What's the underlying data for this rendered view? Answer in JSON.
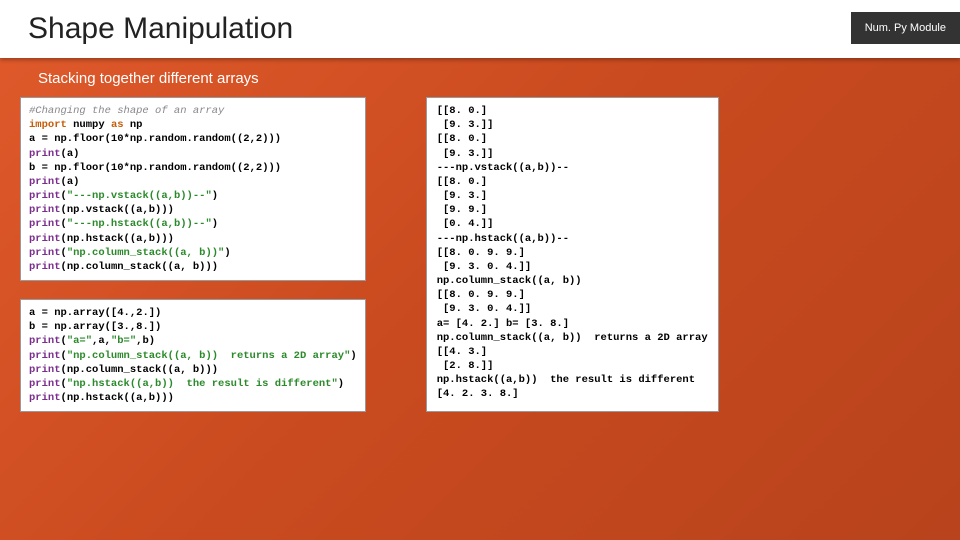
{
  "header": {
    "title": "Shape Manipulation",
    "badge": "Num. Py Module"
  },
  "subtitle": "Stacking together different arrays",
  "code1": {
    "l1": "#Changing the shape of an array",
    "l2_a": "import",
    "l2_b": "numpy",
    "l2_c": "as",
    "l2_d": "np",
    "l3_a": "a = np.",
    "l3_b": "floor(",
    "l3_c": "10",
    "l3_d": "*np.",
    "l3_e": "random.random((",
    "l3_f": "2",
    "l3_g": ",",
    "l3_h": "2",
    "l3_i": ")))",
    "l4_a": "print",
    "l4_b": "(a)",
    "l5_a": "b = np.",
    "l5_b": "floor(",
    "l5_c": "10",
    "l5_d": "*np.",
    "l5_e": "random.random((",
    "l5_f": "2",
    "l5_g": ",",
    "l5_h": "2",
    "l5_i": ")))",
    "l6_a": "print",
    "l6_b": "(a)",
    "l7_a": "print",
    "l7_b": "(",
    "l7_c": "\"---np.vstack((a,b))--\"",
    "l7_d": ")",
    "l8_a": "print",
    "l8_b": "(np.",
    "l8_c": "vstack((a,b)))",
    "l9_a": "print",
    "l9_b": "(",
    "l9_c": "\"---np.hstack((a,b))--\"",
    "l9_d": ")",
    "l10_a": "print",
    "l10_b": "(np.",
    "l10_c": "hstack((a,b)))",
    "l11_a": "print",
    "l11_b": "(",
    "l11_c": "\"np.column_stack((a, b))\"",
    "l11_d": ")",
    "l12_a": "print",
    "l12_b": "(np.",
    "l12_c": "column_stack((a, b)))"
  },
  "code2": {
    "l1_a": "a = np.",
    "l1_b": "array([",
    "l1_c": "4.",
    "l1_d": ",",
    "l1_e": "2.",
    "l1_f": "])",
    "l2_a": "b = np.",
    "l2_b": "array([",
    "l2_c": "3.",
    "l2_d": ",",
    "l2_e": "8.",
    "l2_f": "])",
    "l3_a": "print",
    "l3_b": "(",
    "l3_c": "\"a=\"",
    "l3_d": ",a,",
    "l3_e": "\"b=\"",
    "l3_f": ",b)",
    "l4_a": "print",
    "l4_b": "(",
    "l4_c": "\"np.column_stack((a, b))  returns a 2D array\"",
    "l4_d": ")",
    "l5_a": "print",
    "l5_b": "(np.",
    "l5_c": "column_stack((a, b)))",
    "l6_a": "print",
    "l6_b": "(",
    "l6_c": "\"np.hstack((a,b))  the result is different\"",
    "l6_d": ")",
    "l7_a": "print",
    "l7_b": "(np.",
    "l7_c": "hstack((a,b)))"
  },
  "output": {
    "l1": "[[8. 0.]",
    "l2": " [9. 3.]]",
    "l3": "[[8. 0.]",
    "l4": " [9. 3.]]",
    "l5": "---np.vstack((a,b))--",
    "l6": "[[8. 0.]",
    "l7": " [9. 3.]",
    "l8": " [9. 9.]",
    "l9": " [0. 4.]]",
    "l10": "---np.hstack((a,b))--",
    "l11": "[[8. 0. 9. 9.]",
    "l12": " [9. 3. 0. 4.]]",
    "l13": "np.column_stack((a, b))",
    "l14": "[[8. 0. 9. 9.]",
    "l15": " [9. 3. 0. 4.]]",
    "l16": "a= [4. 2.] b= [3. 8.]",
    "l17": "np.column_stack((a, b))  returns a 2D array",
    "l18": "[[4. 3.]",
    "l19": " [2. 8.]]",
    "l20": "np.hstack((a,b))  the result is different",
    "l21": "[4. 2. 3. 8.]"
  }
}
